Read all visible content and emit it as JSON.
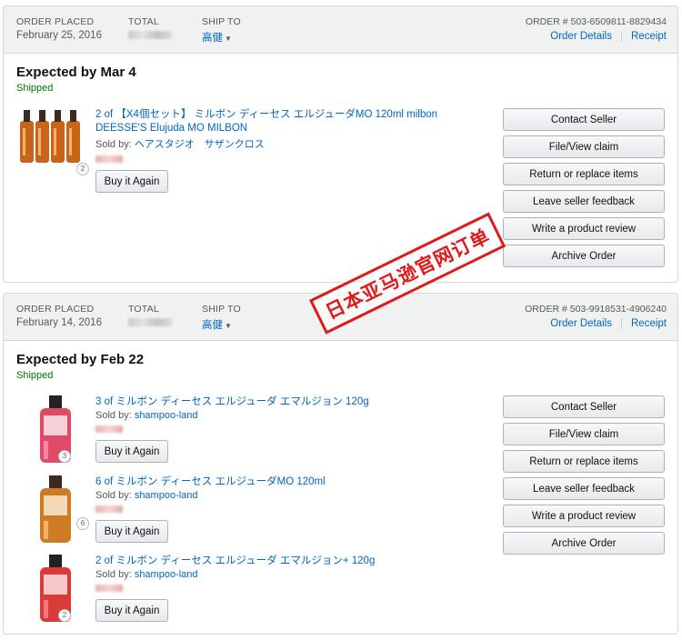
{
  "labels": {
    "order_placed": "ORDER PLACED",
    "total": "TOTAL",
    "ship_to": "SHIP TO",
    "order_details": "Order Details",
    "receipt": "Receipt",
    "shipped": "Shipped",
    "sold_by": "Sold by:",
    "buy_again": "Buy it Again"
  },
  "actions": [
    "Contact Seller",
    "File/View claim",
    "Return or replace items",
    "Leave seller feedback",
    "Write a product review",
    "Archive Order"
  ],
  "orders": [
    {
      "date": "February 25, 2016",
      "ship_to": "高健",
      "order_number": "ORDER # 503-6509811-8829434",
      "expected": "Expected by Mar 4",
      "items": [
        {
          "title": "2 of 【X4個セット】 ミルボン ディーセス エルジューダMO 120ml milbon DEESSE'S Elujuda MO MILBON",
          "seller": "ヘアスタジオ　サザンクロス"
        }
      ]
    },
    {
      "date": "February 14, 2016",
      "ship_to": "高健",
      "order_number": "ORDER # 503-9918531-4906240",
      "expected": "Expected by Feb 22",
      "items": [
        {
          "title": "3 of ミルボン ディーセス エルジューダ エマルジョン 120g",
          "seller": "shampoo-land"
        },
        {
          "title": "6 of ミルボン ディーセス エルジューダMO 120ml",
          "seller": "shampoo-land"
        },
        {
          "title": "2 of ミルボン ディーセス エルジューダ エマルジョン+ 120g",
          "seller": "shampoo-land"
        }
      ]
    }
  ],
  "stamp": "日本亚马逊官网订单",
  "colors": {
    "link": "#0066c0",
    "shipped": "#007600",
    "stamp": "#e0191b",
    "header_bg": "#f0f2f2"
  }
}
